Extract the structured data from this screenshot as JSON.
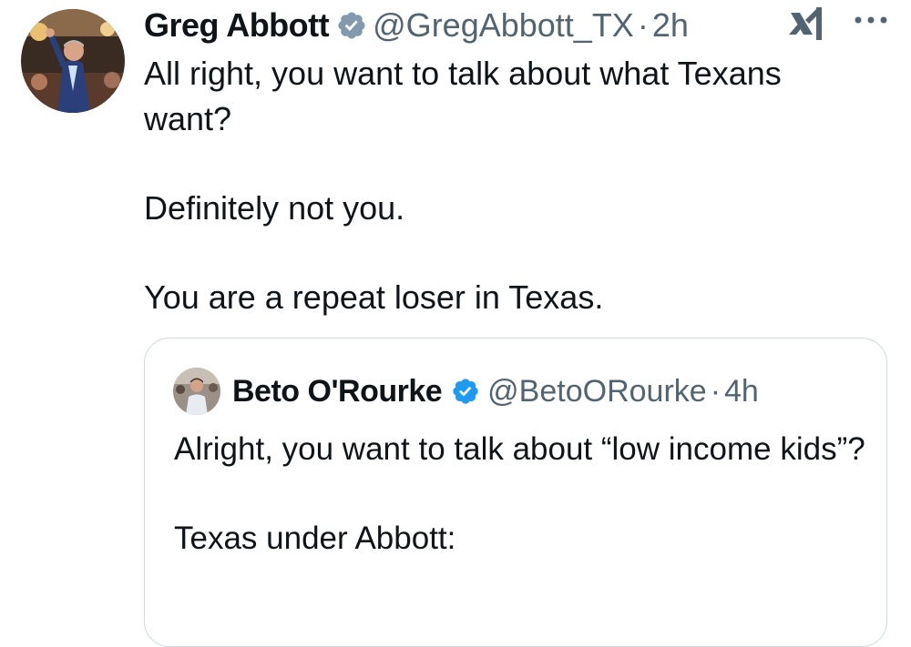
{
  "tweet": {
    "author": {
      "display_name": "Greg Abbott",
      "handle": "@GregAbbott_TX",
      "separator": "·",
      "time": "2h",
      "avatar_icon": "avatar-photo",
      "verified_icon": "verified-badge-icon"
    },
    "text_lines": [
      "All right, you want to talk about what Texans want?",
      "Definitely not you.",
      "You are a repeat loser in Texas."
    ],
    "actions": {
      "grok_icon": "grok-icon",
      "more_icon": "more-options-icon"
    }
  },
  "quoted_tweet": {
    "author": {
      "display_name": "Beto O'Rourke",
      "handle": "@BetoORourke",
      "separator": "·",
      "time": "4h",
      "verified_icon": "verified-badge-icon"
    },
    "text_lines": [
      "Alright, you want to talk about “low income kids”?",
      "Texas under Abbott:"
    ]
  },
  "colors": {
    "text": "#0f1419",
    "secondary": "#536471",
    "verified_blue": "#1d9bf0",
    "verified_gray": "#829aab",
    "border": "#cfd9de"
  }
}
